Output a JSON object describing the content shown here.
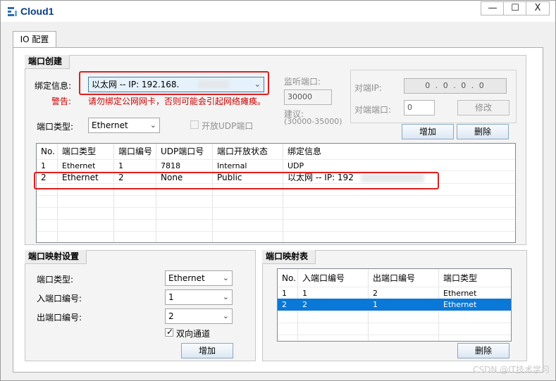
{
  "window": {
    "title": "Cloud1",
    "minimize": "—",
    "maximize": "☐",
    "close": "X"
  },
  "tabs": [
    {
      "label": "IO 配置"
    }
  ],
  "port_create": {
    "group_title": "端口创建",
    "bind_label": "绑定信息:",
    "bind_value": "以太网 -- IP: 192.168.",
    "warn_label": "警告:",
    "warn_text": "请勿绑定公网网卡，否则可能会引起网络瘫痪。",
    "port_type_label": "端口类型:",
    "port_type_value": "Ethernet",
    "open_udp_label": "开放UDP端口",
    "open_udp_checked": false,
    "listen_label": "监听端口:",
    "listen_value": "30000",
    "suggest_label": "建议:",
    "suggest_range": "(30000-35000)",
    "peer_ip_label": "对端IP:",
    "peer_ip_value": "0 . 0 . 0 . 0",
    "peer_port_label": "对端端口:",
    "peer_port_value": "0",
    "modify_button": "修改",
    "add_button": "增加",
    "delete_button": "删除",
    "table": {
      "headers": [
        "No.",
        "端口类型",
        "端口编号",
        "UDP端口号",
        "端口开放状态",
        "绑定信息"
      ],
      "rows": [
        [
          "1",
          "Ethernet",
          "1",
          "7818",
          "Internal",
          "UDP"
        ],
        [
          "2",
          "Ethernet",
          "2",
          "None",
          "Public",
          "以太网 -- IP: 192"
        ]
      ]
    }
  },
  "port_map_settings": {
    "group_title": "端口映射设置",
    "port_type_label": "端口类型:",
    "port_type_value": "Ethernet",
    "in_port_label": "入端口编号:",
    "in_port_value": "1",
    "out_port_label": "出端口编号:",
    "out_port_value": "2",
    "bidirectional_label": "双向通道",
    "bidirectional_checked": true,
    "add_button": "增加"
  },
  "port_map_table": {
    "group_title": "端口映射表",
    "headers": [
      "No.",
      "入端口编号",
      "出端口编号",
      "端口类型"
    ],
    "rows": [
      [
        "1",
        "1",
        "2",
        "Ethernet"
      ],
      [
        "2",
        "2",
        "1",
        "Ethernet"
      ]
    ],
    "selected_row": 2,
    "delete_button": "删除"
  },
  "watermark": "CSDN @IT技术学习",
  "colors": {
    "highlight_red": "#e01e1e",
    "selection_blue": "#0a78d7",
    "warning_red": "#cc0000"
  }
}
